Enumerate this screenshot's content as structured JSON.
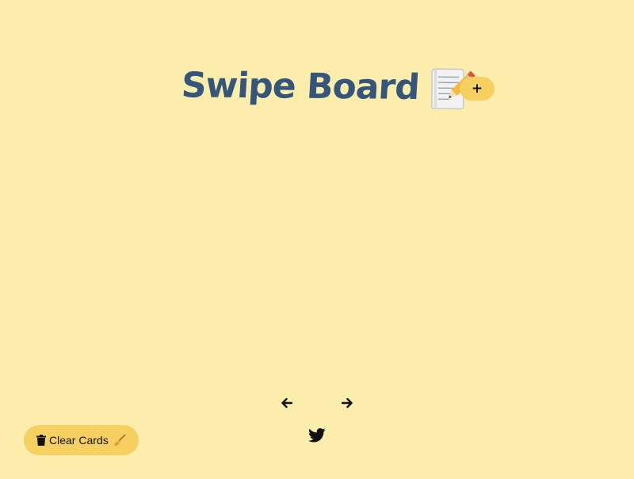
{
  "header": {
    "title": "Swipe Board",
    "title_icon": "memo-icon",
    "add_label": "+"
  },
  "nav": {
    "prev_icon": "arrow-left-icon",
    "next_icon": "arrow-right-icon"
  },
  "footer": {
    "clear_label": "Clear Cards",
    "clear_icon": "trash-icon",
    "clear_emoji_icon": "broom-icon",
    "social_icon": "twitter-icon"
  },
  "colors": {
    "background": "#fbeeac",
    "title": "#35557a",
    "button": "#f6d060"
  }
}
